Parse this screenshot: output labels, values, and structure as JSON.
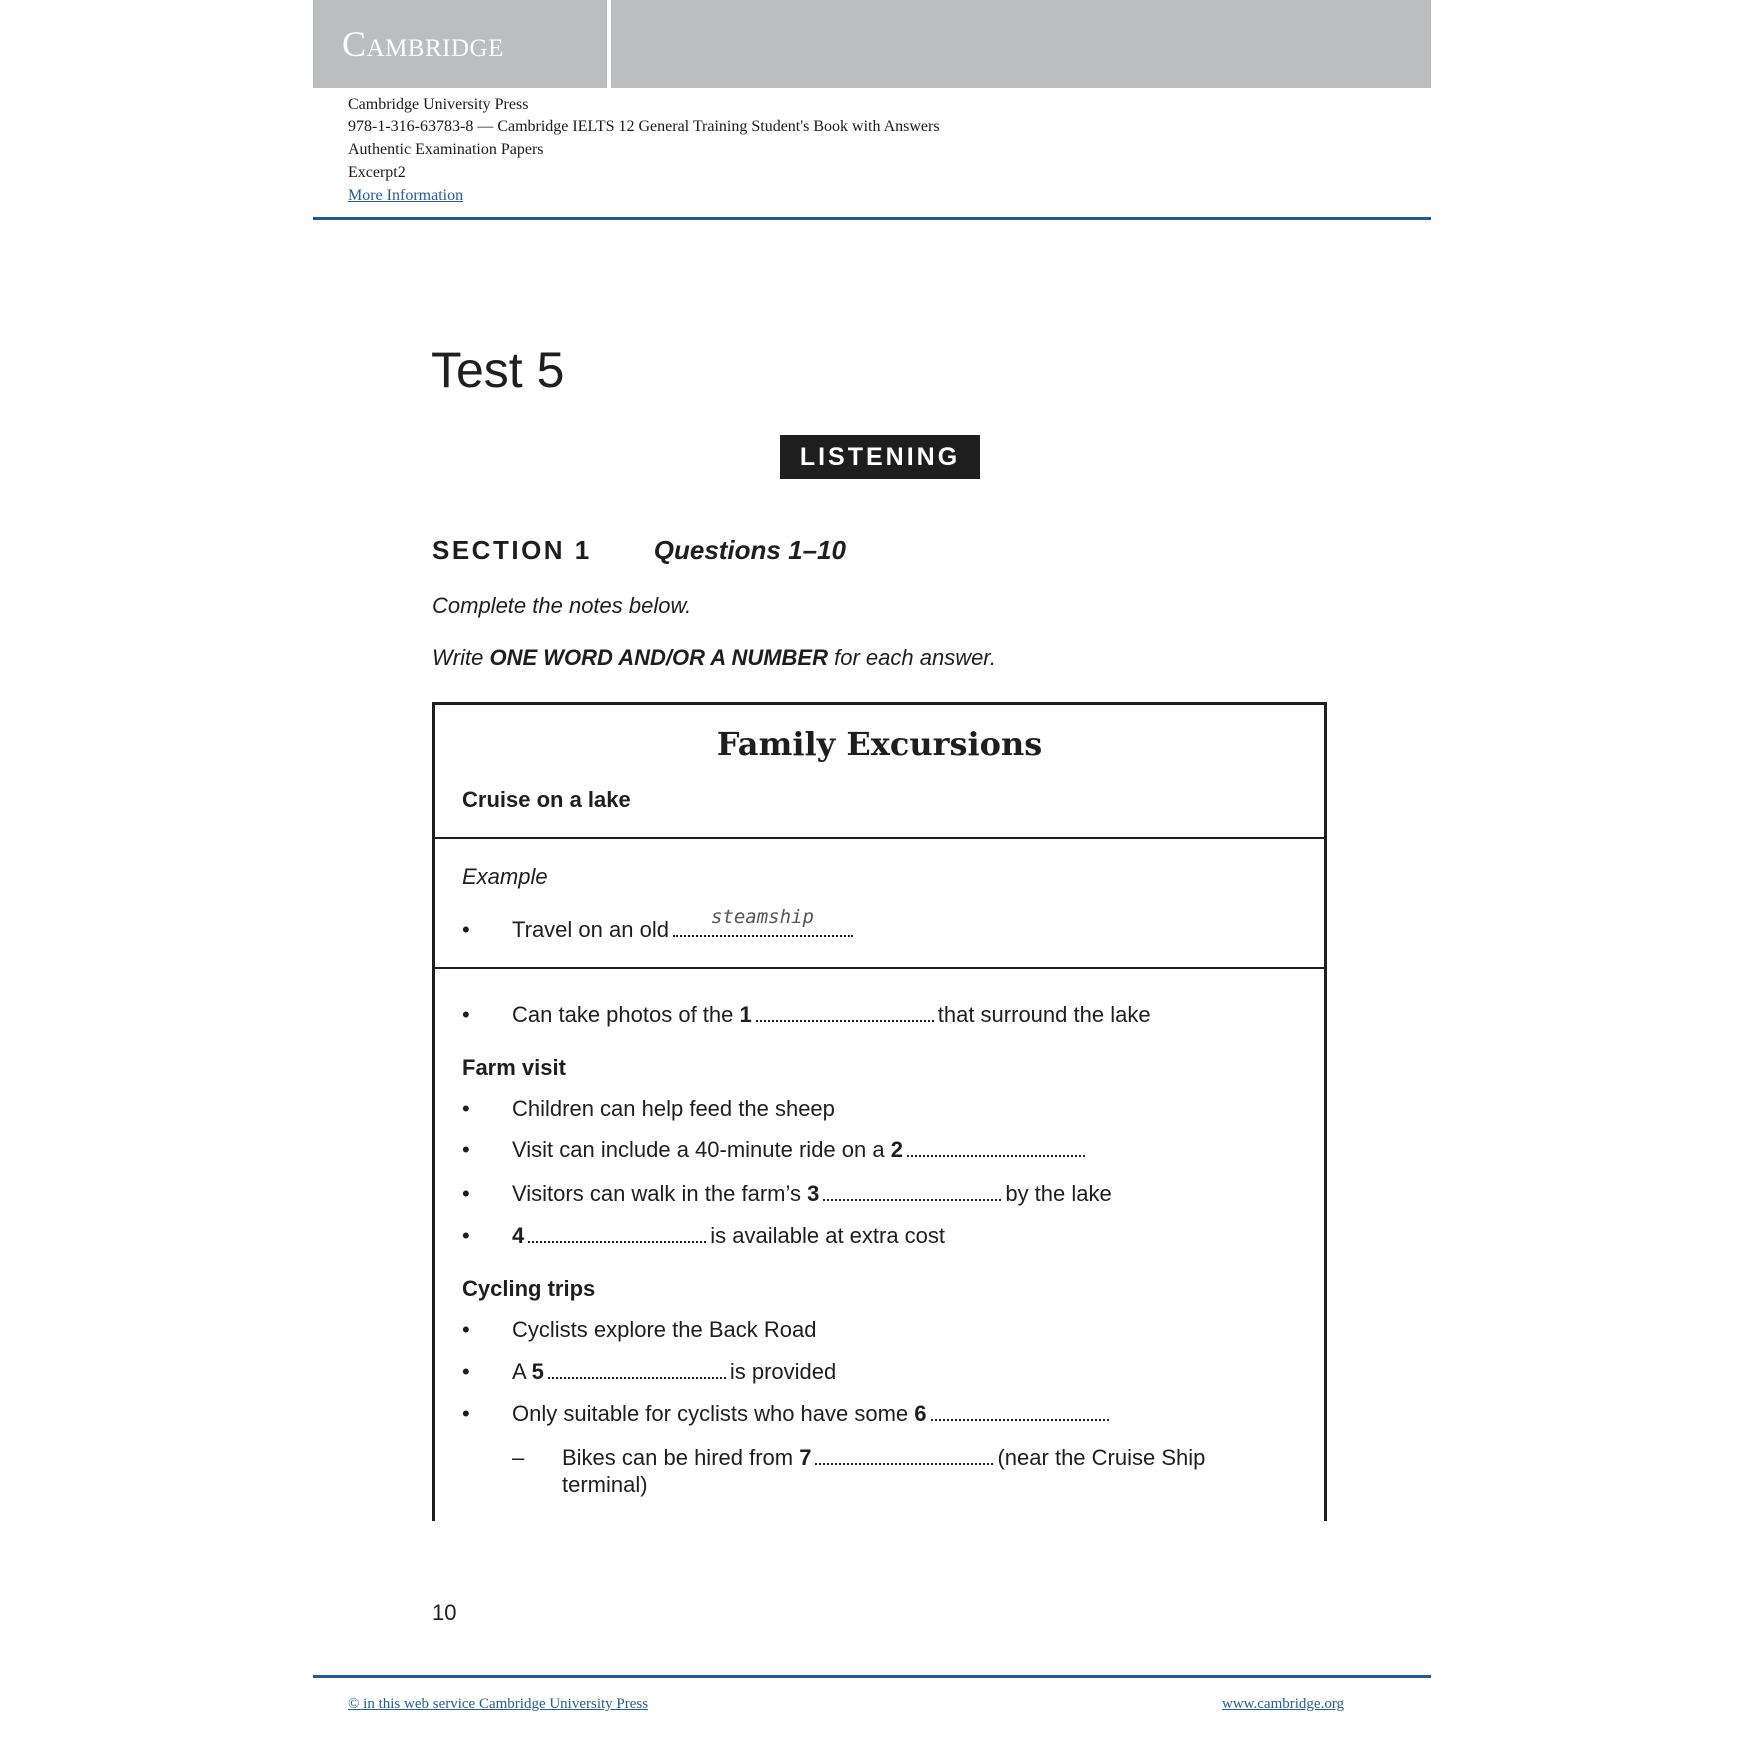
{
  "header": {
    "logo": "Cambridge",
    "publisher": "Cambridge University Press",
    "book_line": "978-1-316-63783-8 — Cambridge IELTS 12 General Training Student's Book with Answers",
    "subtitle": "Authentic Examination Papers",
    "excerpt": "Excerpt2",
    "more_info_link": "More Information"
  },
  "page": {
    "test_title": "Test 5",
    "section_badge": "LISTENING",
    "section_label": "SECTION 1",
    "section_questions": "Questions 1–10",
    "instruction_1": "Complete the notes below.",
    "instruction_2_pre": "Write ",
    "instruction_2_bold": "ONE WORD AND/OR A NUMBER",
    "instruction_2_post": " for each answer.",
    "page_number": "10"
  },
  "notes": {
    "title": "Family Excursions",
    "cruise_heading": "Cruise on a lake",
    "example_label": "Example",
    "example": {
      "bullet": "•",
      "pre": "Travel on an old",
      "answer": "steamship"
    },
    "cruise_items": [
      {
        "bullet": "•",
        "pre": "Can take photos of the ",
        "q": "1",
        "post": "that surround the lake"
      }
    ],
    "farm_heading": "Farm visit",
    "farm_items": [
      {
        "bullet": "•",
        "text": "Children can help feed the sheep"
      },
      {
        "bullet": "•",
        "pre": "Visit can include a 40-minute ride on a ",
        "q": "2",
        "post": ""
      },
      {
        "bullet": "•",
        "pre": "Visitors can walk in the farm’s ",
        "q": "3",
        "post": "by the lake"
      },
      {
        "bullet": "•",
        "pre": "",
        "q": "4",
        "post": "is available at extra cost"
      }
    ],
    "cycling_heading": "Cycling trips",
    "cycling_items": [
      {
        "bullet": "•",
        "text": "Cyclists explore the Back Road"
      },
      {
        "bullet": "•",
        "pre": "A ",
        "q": "5",
        "post": "is provided"
      },
      {
        "bullet": "•",
        "pre": "Only suitable for cyclists who have some ",
        "q": "6",
        "post": ""
      }
    ],
    "cycling_sub_items": [
      {
        "dash": "–",
        "pre": "Bikes can be hired from ",
        "q": "7",
        "post": "(near the Cruise Ship",
        "continuation": "terminal)"
      }
    ]
  },
  "footer": {
    "copyright_link": "© in this web service Cambridge University Press",
    "site_link": "www.cambridge.org"
  },
  "colors": {
    "header_band": "#bcbdbf",
    "rule_blue": "#24598a",
    "link_blue": "#2a5d8f",
    "text_dark": "#1e1e1e"
  }
}
